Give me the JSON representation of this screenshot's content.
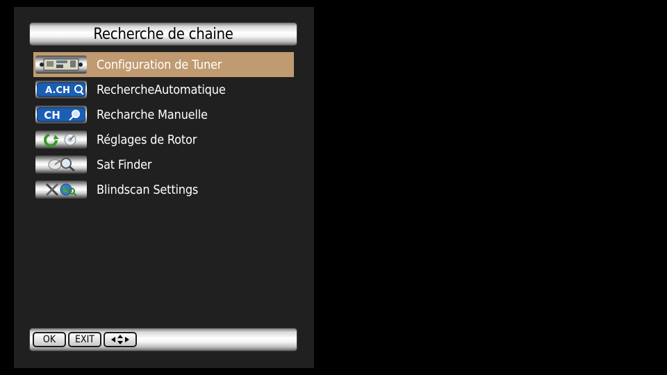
{
  "title": "Recherche de chaine",
  "menu": [
    {
      "label": "Configuration de Tuner",
      "icon": "tuner-board-icon",
      "selected": true
    },
    {
      "label": "RechercheAutomatique",
      "icon": "auto-channel-search-icon",
      "icon_text": "A.CH",
      "selected": false
    },
    {
      "label": "Recharche Manuelle",
      "icon": "manual-channel-search-icon",
      "icon_text": "CH",
      "selected": false
    },
    {
      "label": "Réglages de Rotor",
      "icon": "rotor-dish-icon",
      "selected": false
    },
    {
      "label": "Sat Finder",
      "icon": "satellite-magnifier-icon",
      "selected": false
    },
    {
      "label": "Blindscan Settings",
      "icon": "tools-globe-icon",
      "selected": false
    }
  ],
  "footer": {
    "ok_label": "OK",
    "exit_label": "EXIT",
    "nav_icon": "arrows-navigation-icon"
  },
  "colors": {
    "selection": "#c09a70",
    "panel": "#202020",
    "background": "#000000"
  }
}
